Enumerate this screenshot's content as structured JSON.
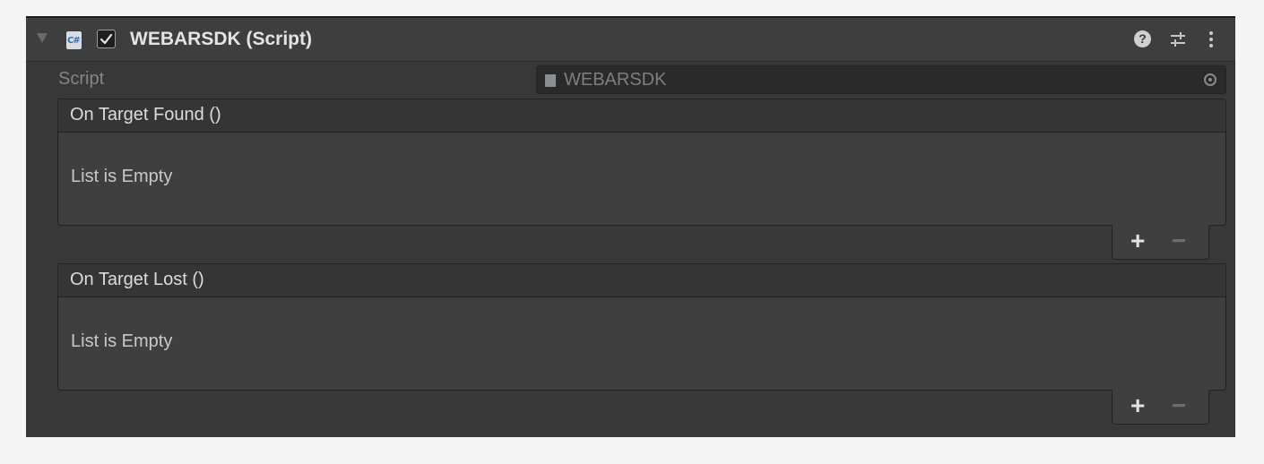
{
  "component": {
    "title": "WEBARSDK (Script)",
    "enabled": true,
    "icons": [
      "foldout-arrow-icon",
      "csharp-script-icon",
      "help-icon",
      "preset-sliders-icon",
      "more-kebab-icon"
    ]
  },
  "script_field": {
    "label": "Script",
    "value": "WEBARSDK"
  },
  "events": [
    {
      "header": "On Target Found ()",
      "empty_text": "List is Empty",
      "add_label": "+",
      "remove_label": "−"
    },
    {
      "header": "On Target Lost ()",
      "empty_text": "List is Empty",
      "add_label": "+",
      "remove_label": "−"
    }
  ],
  "colors": {
    "panel_bg": "#383838",
    "header_bg": "#3e3e3e",
    "field_bg": "#2a2a2a",
    "event_bg": "#3f3f3f"
  }
}
